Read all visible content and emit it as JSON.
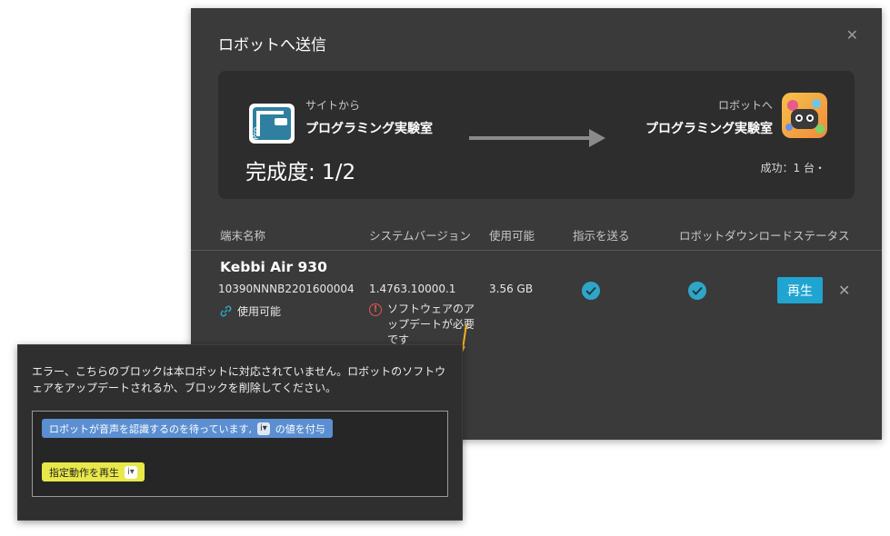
{
  "dialog": {
    "title": "ロボットへ送信",
    "source_label": "サイトから",
    "source_name": "プログラミング実験室",
    "destination_label": "ロボットへ",
    "destination_name": "プログラミング実験室",
    "progress_text": "完成度: 1/2",
    "success_text": "成功：1 台・"
  },
  "table": {
    "headers": [
      "端末名称",
      "システムバージョン",
      "使用可能",
      "指示を送る",
      "ロボットダウンロードステータス"
    ],
    "row": {
      "device_name": "Kebbi Air 930",
      "serial": "10390NNNB2201600004",
      "status": "使用可能",
      "version": "1.4763.10000.1",
      "warning": "ソフトウェアのアップデートが必要です",
      "storage": "3.56 GB",
      "play_label": "再生"
    }
  },
  "tooltip": {
    "message": "エラー、こちらのブロックは本ロボットに対応されていません。ロボットのソフトウェアをアップデートされるか、ブロックを削除してください。",
    "block1_text": "ロボットが音声を認識するのを待っています,",
    "block1_slot": "i",
    "block1_suffix": "の値を付与",
    "block2_text": "指定動作を再生",
    "block2_slot": "i"
  },
  "colors": {
    "accent": "#20a5d1",
    "check": "#2fa6c8",
    "warning": "#e05555",
    "callout": "#f5b020",
    "block_blue": "#5b8fd1",
    "block_yellow": "#e8e84a"
  },
  "icons": [
    "close-icon",
    "pro-logo",
    "arrow-right-icon",
    "robot-app-icon",
    "link-icon",
    "warning-icon",
    "check-icon"
  ]
}
